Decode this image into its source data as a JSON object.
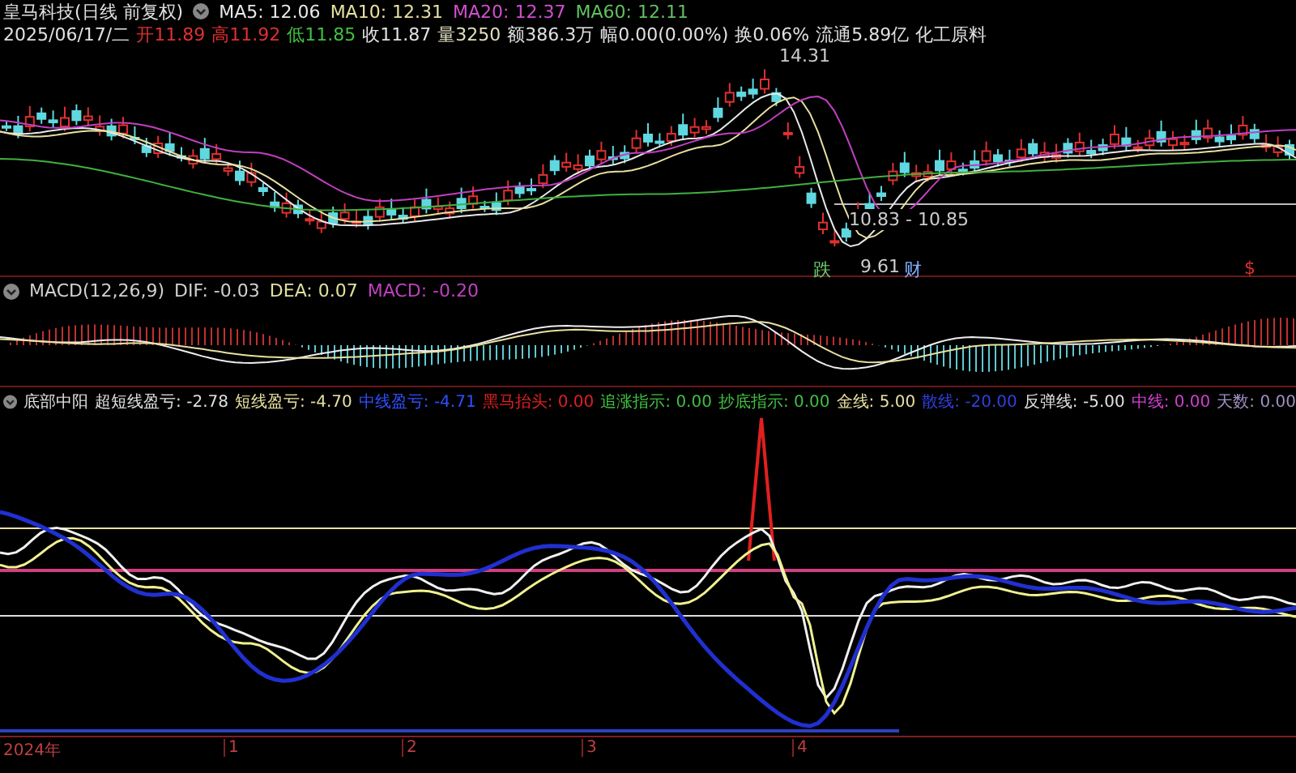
{
  "stock_header": {
    "title": "皇马科技(日线 前复权)",
    "ma_items": [
      {
        "text": "MA5: 12.06",
        "color": "#e8e8e8"
      },
      {
        "text": "MA10: 12.31",
        "color": "#e8e0a0"
      },
      {
        "text": "MA20: 12.37",
        "color": "#d050d0"
      },
      {
        "text": "MA60: 12.11",
        "color": "#60c060"
      }
    ],
    "quote_items": [
      {
        "text": "2025/06/17/二",
        "color": "#e0e0e0"
      },
      {
        "text": "开11.89",
        "color": "#e03030"
      },
      {
        "text": "高11.92",
        "color": "#e03030"
      },
      {
        "text": "低11.85",
        "color": "#40c040"
      },
      {
        "text": "收11.87",
        "color": "#e0e0e0"
      },
      {
        "text": "量3250",
        "color": "#e0e0c0"
      },
      {
        "text": "额386.3万",
        "color": "#e0e0e0"
      },
      {
        "text": "幅0.00(0.00%)",
        "color": "#e0e0e0"
      },
      {
        "text": "换0.06%",
        "color": "#e0e0e0"
      },
      {
        "text": "流通5.89亿",
        "color": "#e0e0e0"
      },
      {
        "text": "化工原料",
        "color": "#e0e0e0"
      }
    ]
  },
  "price_annotations": [
    "14.31",
    "10.83 - 10.85",
    "9.61"
  ],
  "event_markers": [
    {
      "text": "跌",
      "color": "#70d070"
    },
    {
      "text": "财",
      "color": "#80b0ff"
    },
    {
      "text": "$",
      "color": "#e03030"
    }
  ],
  "macd_header": {
    "items": [
      {
        "text": "MACD(12,26,9)",
        "color": "#d0d0d0"
      },
      {
        "text": "DIF: -0.03",
        "color": "#d0d0d0"
      },
      {
        "text": "DEA: 0.07",
        "color": "#e0e0a0"
      },
      {
        "text": "MACD: -0.20",
        "color": "#c040c0"
      }
    ]
  },
  "indicator_header": {
    "items": [
      {
        "text": "底部中阳",
        "color": "#e0e0e0"
      },
      {
        "text": "超短线盈亏: -2.78",
        "color": "#e0e0e0"
      },
      {
        "text": "短线盈亏: -4.70",
        "color": "#e8e0a0"
      },
      {
        "text": "中线盈亏: -4.71",
        "color": "#3050ff"
      },
      {
        "text": "黑马抬头: 0.00",
        "color": "#e02020"
      },
      {
        "text": "追涨指示: 0.00",
        "color": "#40c040"
      },
      {
        "text": "抄底指示: 0.00",
        "color": "#40c040"
      },
      {
        "text": "金线: 5.00",
        "color": "#e8e0a0"
      },
      {
        "text": "散线: -20.00",
        "color": "#3040e0"
      },
      {
        "text": "反弹线: -5.00",
        "color": "#e0e0e0"
      },
      {
        "text": "中线: 0.00",
        "color": "#d040d0"
      },
      {
        "text": "天数: 0.00",
        "color": "#a090c0"
      }
    ]
  },
  "time_axis": [
    "2024年",
    "1",
    "2",
    "3",
    "4"
  ]
}
